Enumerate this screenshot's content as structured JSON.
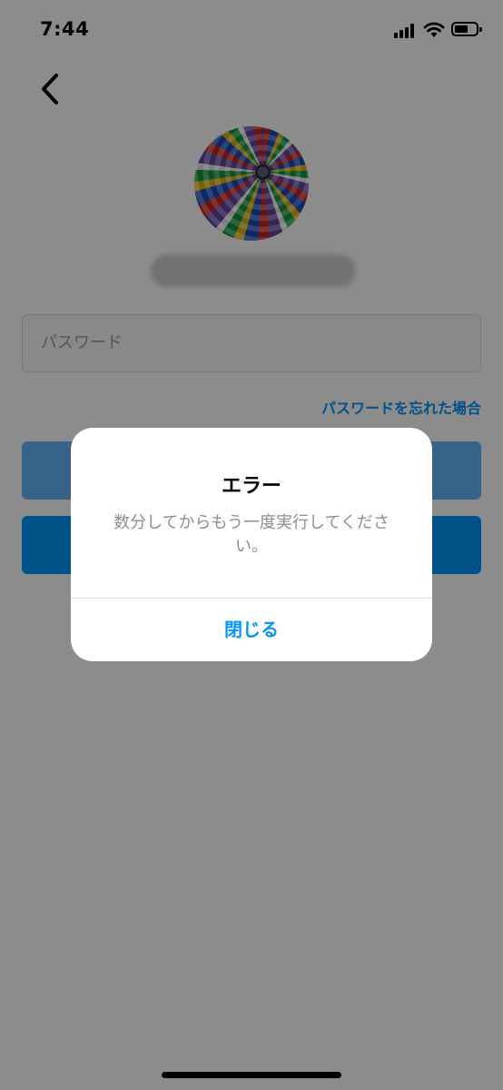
{
  "status_bar": {
    "time": "7:44"
  },
  "login": {
    "password_placeholder": "パスワード",
    "forgot_password": "パスワードを忘れた場合"
  },
  "dialog": {
    "title": "エラー",
    "message": "数分してからもう一度実行してください。",
    "close_label": "閉じる"
  },
  "colors": {
    "accent": "#0095f6",
    "login_button": "#67b5f9",
    "overlay": "rgba(0,0,0,0.45)"
  },
  "icons": {
    "back": "chevron-left-icon",
    "signal": "cellular-signal-icon",
    "wifi": "wifi-icon",
    "battery": "battery-icon"
  }
}
